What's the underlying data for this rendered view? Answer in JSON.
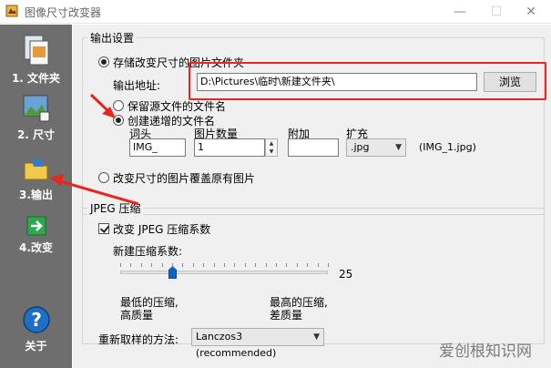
{
  "window": {
    "title": "图像尺寸改变器",
    "controls": {
      "minimize": "—",
      "maximize": "☐",
      "close": "✕"
    }
  },
  "sidebar": {
    "items": [
      {
        "label": "1. 文件夹",
        "icon": "files-icon"
      },
      {
        "label": "2. 尺寸",
        "icon": "image-resize-icon"
      },
      {
        "label": "3.输出",
        "icon": "folder-output-icon"
      },
      {
        "label": "4.改变",
        "icon": "arrow-right-icon"
      },
      {
        "label": "关于",
        "icon": "help-icon"
      }
    ]
  },
  "output_settings": {
    "title": "输出设置",
    "save_radio": "存储改变尺寸的图片文件夹",
    "address_label": "输出地址:",
    "address_value": "D:\\Pictures\\临时\\新建文件夹\\",
    "browse_button": "浏览",
    "keep_name_radio": "保留源文件的文件名",
    "increment_radio": "创建递增的文件名",
    "prefix_label": "词头",
    "prefix_value": "IMG_",
    "count_label": "图片数量",
    "count_value": "1",
    "append_label": "附加",
    "append_value": "",
    "ext_label": "扩充",
    "ext_value": ".jpg",
    "example": "(IMG_1.jpg)",
    "overwrite_radio": "改变尺寸的图片覆盖原有图片"
  },
  "jpeg": {
    "title": "JPEG 压缩",
    "change_checkbox": "改变 JPEG 压缩系数",
    "new_label": "新建压缩系数:",
    "slider_value": "25",
    "slider_fraction": 0.25,
    "low_label_1": "最低的压缩,",
    "low_label_2": "高质量",
    "high_label_1": "最高的压缩,",
    "high_label_2": "差质量"
  },
  "resample": {
    "label": "重新取样的方法:",
    "value": "Lanczos3 (recommended)"
  },
  "watermark": "爱创根知识网"
}
